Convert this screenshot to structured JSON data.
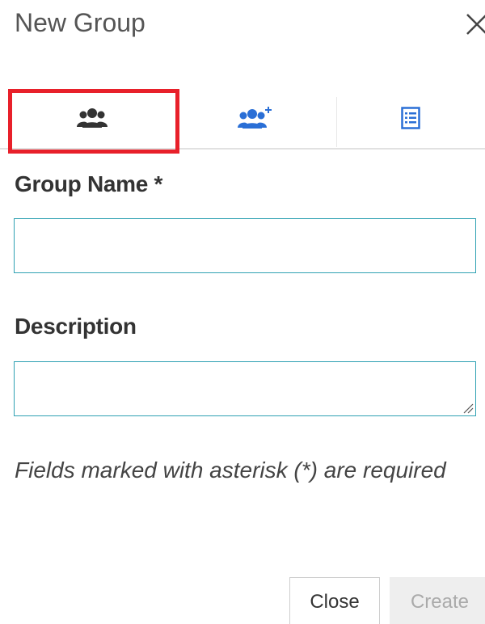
{
  "dialog": {
    "title": "New Group"
  },
  "tabs": [
    {
      "icon": "group-icon",
      "selected": true
    },
    {
      "icon": "add-group-icon",
      "selected": false
    },
    {
      "icon": "list-icon",
      "selected": false
    }
  ],
  "form": {
    "group_name_label": "Group Name *",
    "group_name_value": "",
    "description_label": "Description",
    "description_value": "",
    "required_note": "Fields marked with asterisk (*) are required"
  },
  "buttons": {
    "close_label": "Close",
    "create_label": "Create"
  },
  "colors": {
    "accent": "#2fa1b3",
    "tab_icon_active": "#333333",
    "tab_icon": "#2a6fd6",
    "highlight": "#e8202a"
  }
}
